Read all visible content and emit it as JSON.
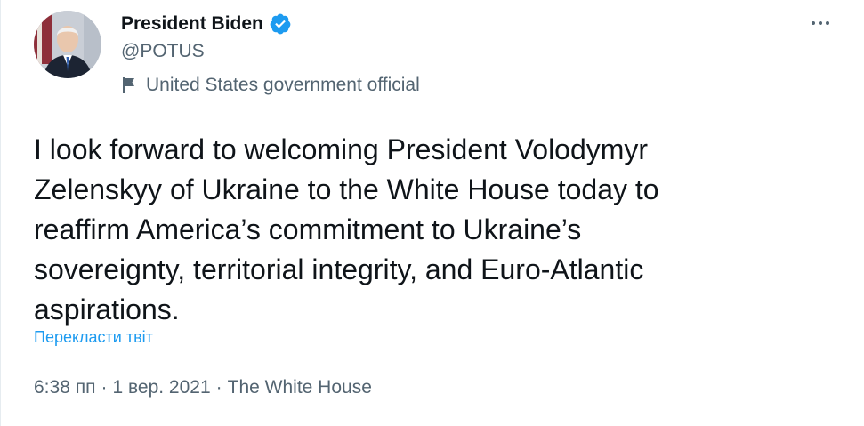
{
  "author": {
    "name": "President Biden",
    "handle": "@POTUS",
    "label": "United States government official",
    "avatar_icon": "avatar-photo",
    "verified_icon": "verified-badge-icon",
    "label_icon": "flag-icon"
  },
  "tweet": {
    "text": "I look forward to welcoming President Volodymyr\nZelenskyy of Ukraine to the White House today to\nreaffirm America’s commitment to Ukraine’s\nsovereignty, territorial integrity, and Euro-Atlantic\naspirations.",
    "translate_label": "Перекласти твіт",
    "time": "6:38 пп",
    "date": "1 вер. 2021",
    "source": "The White House",
    "separator": "·"
  },
  "menu": {
    "icon": "more-options-icon"
  },
  "colors": {
    "accent": "#1d9bf0",
    "text_primary": "#0f1419",
    "text_secondary": "#536471"
  }
}
